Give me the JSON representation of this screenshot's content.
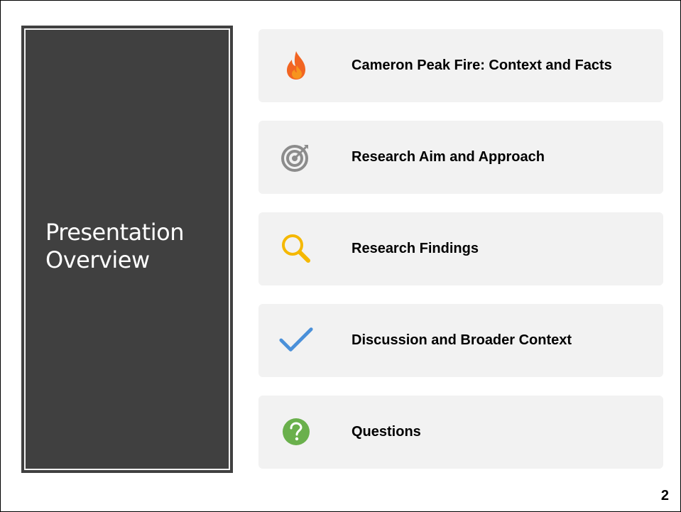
{
  "slide": {
    "title": "Presentation Overview",
    "page_number": "2"
  },
  "agenda": {
    "items": [
      {
        "label": "Cameron Peak Fire: Context and Facts",
        "icon": "fire-icon",
        "color": "#f26522"
      },
      {
        "label": "Research Aim and Approach",
        "icon": "target-icon",
        "color": "#8c8c8c"
      },
      {
        "label": "Research Findings",
        "icon": "magnifier-icon",
        "color": "#f5b800"
      },
      {
        "label": "Discussion and Broader Context",
        "icon": "checkmark-icon",
        "color": "#4a90d9"
      },
      {
        "label": "Questions",
        "icon": "question-mark-icon",
        "color": "#6ab04c"
      }
    ]
  },
  "colors": {
    "title_panel": "#404040",
    "item_background": "#f2f2f2"
  }
}
